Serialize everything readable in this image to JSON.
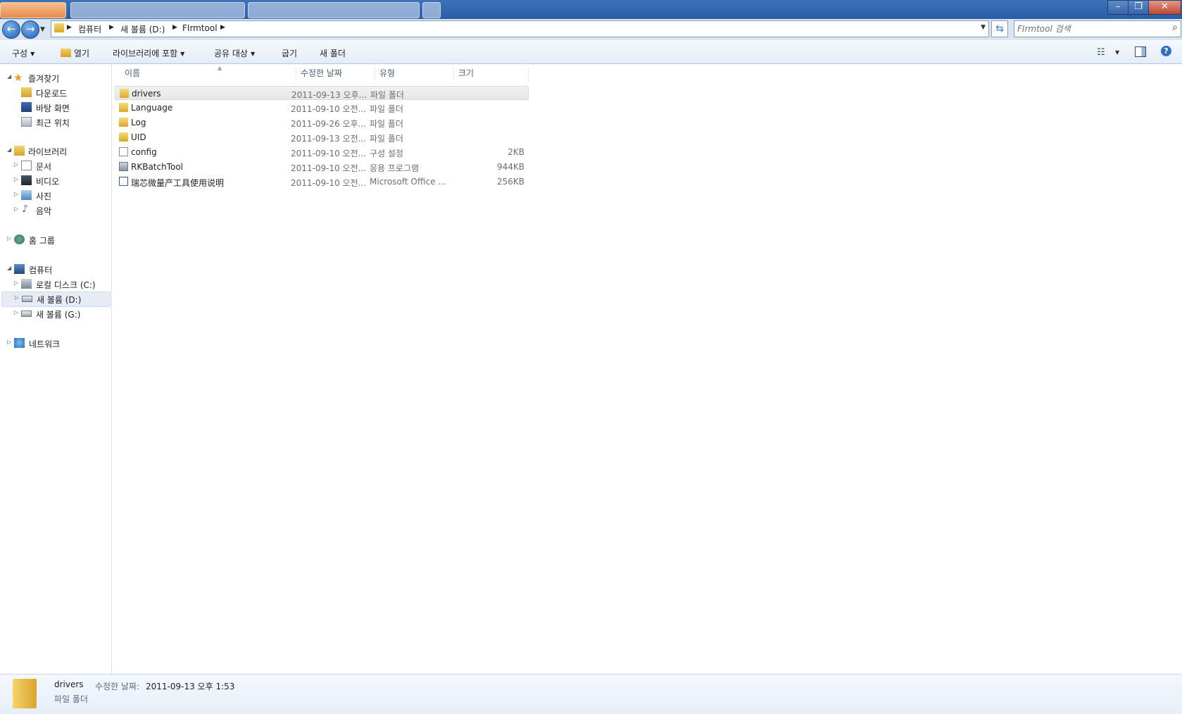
{
  "window": {
    "minimize": "–",
    "maximize": "❐",
    "close": "✕"
  },
  "address": {
    "crumbs": [
      "컴퓨터",
      "새 볼륨 (D:)",
      "FIrmtool"
    ],
    "search_placeholder": "FIrmtool 검색"
  },
  "toolbar": {
    "organize": "구성",
    "open": "열기",
    "include_in_library": "라이브러리에 포함",
    "share_with": "공유 대상",
    "burn": "굽기",
    "new_folder": "새 폴더"
  },
  "nav": {
    "favorites": "즐겨찾기",
    "downloads": "다운로드",
    "desktop": "바탕 화면",
    "recent": "최근 위치",
    "libraries": "라이브러리",
    "documents": "문서",
    "videos": "비디오",
    "pictures": "사진",
    "music": "음악",
    "homegroup": "홈 그룹",
    "computer": "컴퓨터",
    "local_c": "로컬 디스크 (C:)",
    "vol_d": "새 볼륨 (D:)",
    "vol_g": "새 볼륨 (G:)",
    "network": "네트워크"
  },
  "columns": {
    "name": "이름",
    "date": "수정한 날짜",
    "type": "유형",
    "size": "크기"
  },
  "files": [
    {
      "name": "drivers",
      "date": "2011-09-13 오후...",
      "type": "파일 폴더",
      "size": "",
      "icon": "folder-icon"
    },
    {
      "name": "Language",
      "date": "2011-09-10 오전...",
      "type": "파일 폴더",
      "size": "",
      "icon": "folder-icon"
    },
    {
      "name": "Log",
      "date": "2011-09-26 오후...",
      "type": "파일 폴더",
      "size": "",
      "icon": "folder-icon"
    },
    {
      "name": "UID",
      "date": "2011-09-13 오전...",
      "type": "파일 폴더",
      "size": "",
      "icon": "folder-icon"
    },
    {
      "name": "config",
      "date": "2011-09-10 오전...",
      "type": "구성 설정",
      "size": "2KB",
      "icon": "config-file-icon"
    },
    {
      "name": "RKBatchTool",
      "date": "2011-09-10 오전...",
      "type": "응용 프로그램",
      "size": "944KB",
      "icon": "application-icon"
    },
    {
      "name": "瑞芯微量产工具使用说明",
      "date": "2011-09-10 오전...",
      "type": "Microsoft Office ...",
      "size": "256KB",
      "icon": "word-document-icon"
    }
  ],
  "details": {
    "name": "drivers",
    "date_label": "수정한 날짜:",
    "date": "2011-09-13 오후 1:53",
    "type": "파일 폴더"
  }
}
